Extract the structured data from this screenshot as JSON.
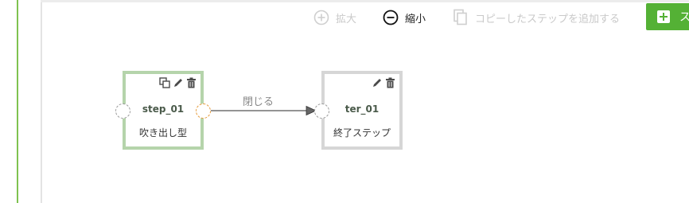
{
  "toolbar": {
    "zoom_in_label": "拡大",
    "zoom_out_label": "縮小",
    "add_copied_label": "コピーしたステップを追加する",
    "add_step_label": "ス"
  },
  "flow": {
    "nodes": [
      {
        "id": "step_01",
        "subtitle": "吹き出し型"
      },
      {
        "id": "ter_01",
        "subtitle": "終了ステップ"
      }
    ],
    "edge_label": "閉じる"
  },
  "colors": {
    "accent": "#54b135",
    "start_node_border": "#b5d4ab",
    "end_node_border": "#d6d6d6",
    "port_active": "#e69a3a"
  }
}
